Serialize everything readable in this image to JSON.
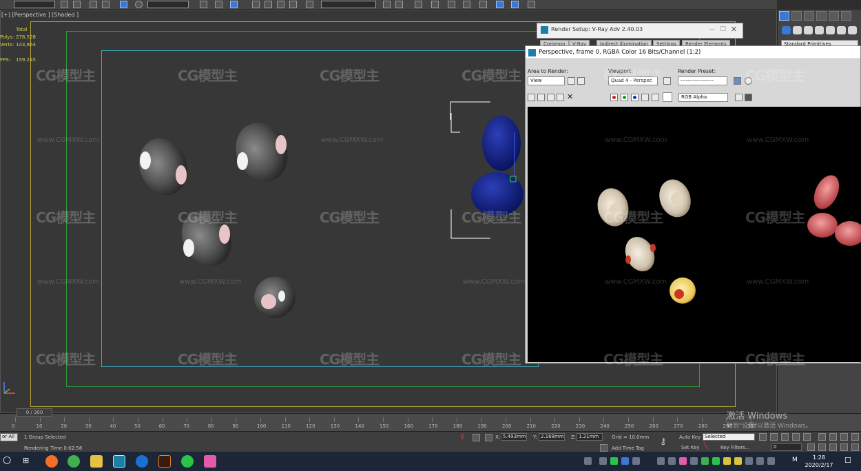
{
  "viewport": {
    "label": "[+] [Perspective ] [Shaded ]",
    "stats": {
      "header": "Total",
      "polys_label": "Polys:",
      "polys_value": "278,528",
      "verts_label": "Verts:",
      "verts_value": "143,864",
      "fps_label": "FPS:",
      "fps_value": "159.245"
    }
  },
  "render_setup": {
    "title": "Render Setup: V-Ray Adv 2.40.03",
    "tabs": [
      "Common",
      "V-Ray",
      "Indirect illumination",
      "Settings",
      "Render Elements"
    ]
  },
  "frame_buffer": {
    "title": "Perspective, frame 0, RGBA Color 16 Bits/Channel (1:2)",
    "area_label": "Area to Render:",
    "area_value": "View",
    "viewport_label": "Viewport:",
    "viewport_value": "Quad 4 - Perspec",
    "preset_label": "Render Preset:",
    "preset_value": "-------------------",
    "channel_value": "RGB Alpha"
  },
  "command_panel": {
    "primitives": "Standard Primitives"
  },
  "timeline": {
    "slider": "0 / 300",
    "ticks": [
      "0",
      "10",
      "20",
      "30",
      "40",
      "50",
      "60",
      "70",
      "80",
      "90",
      "100",
      "110",
      "120",
      "130",
      "140",
      "150",
      "160",
      "170",
      "180",
      "190",
      "200",
      "210",
      "220",
      "230",
      "240",
      "250",
      "260",
      "270",
      "280",
      "290",
      "300"
    ]
  },
  "status": {
    "selection": "1 Group Selected",
    "rendering_time": "Rendering Time  0:02:58",
    "x_label": "X:",
    "x_value": "5.493mm",
    "y_label": "Y:",
    "y_value": "2.168mm",
    "z_label": "Z:",
    "z_value": "1.21mm",
    "grid": "Grid = 10.0mm",
    "add_time_tag": "Add Time Tag",
    "auto_key": "Auto Key",
    "auto_key_value": "Selected",
    "set_key": "Set Key",
    "key_filters": "Key Filters...",
    "frame_value": "0",
    "left_field": "or All"
  },
  "windows": {
    "activate_line1": "激活 Windows",
    "activate_line2": "转到\"设置\"以激活 Windows。",
    "clock_time": "1:28",
    "clock_date": "2020/2/17",
    "ime": "M"
  },
  "watermark": {
    "logo": "CG模型主",
    "url": "www.CGMXW.com"
  },
  "colors": {
    "viewport_bg": "#373737",
    "frame_yellow": "#b7a33a",
    "frame_green": "#2f9a3a",
    "frame_cyan": "#3aa7b8",
    "stats_text": "#d6cf4a",
    "accent_blue": "#3a78d6",
    "taskbar": "#1c2636"
  }
}
